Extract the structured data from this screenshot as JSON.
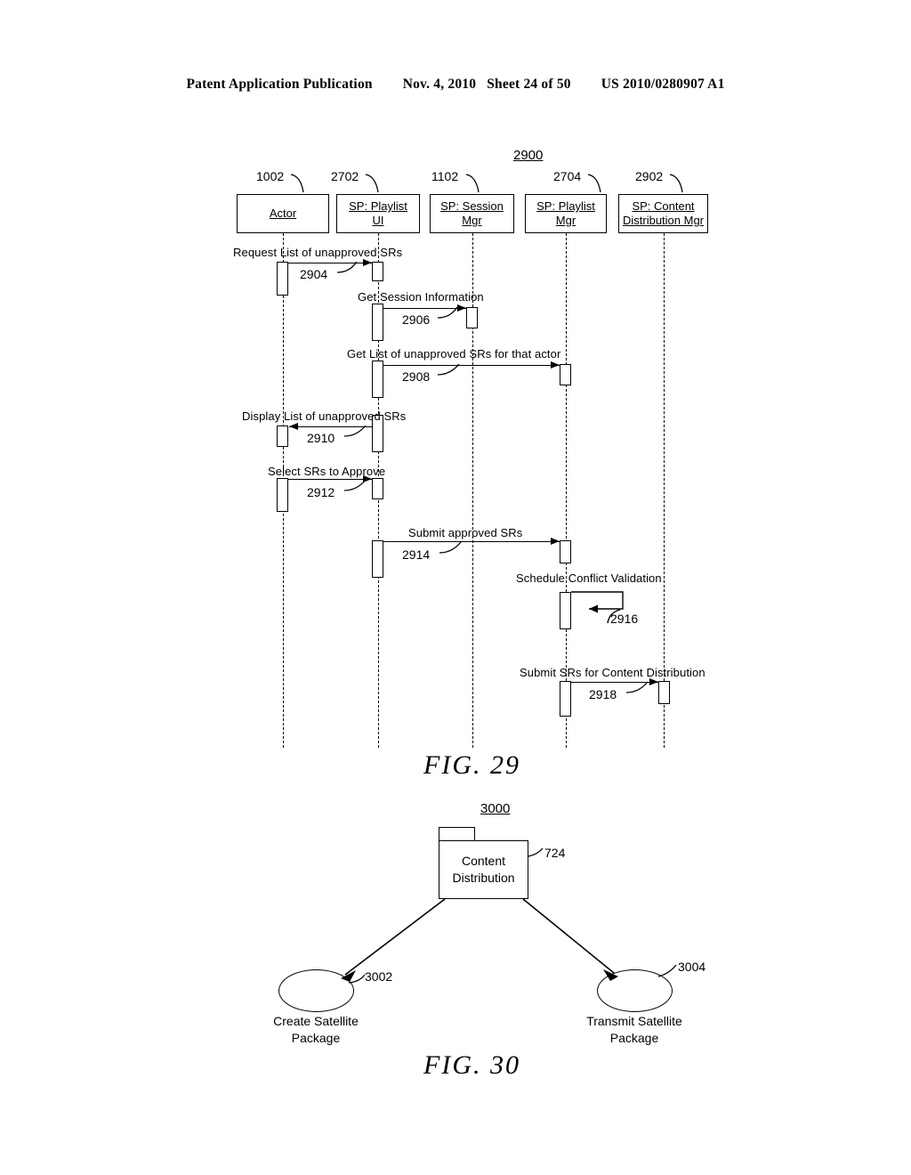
{
  "header": {
    "publication": "Patent Application Publication",
    "date": "Nov. 4, 2010",
    "sheet": "Sheet 24 of 50",
    "patent_number": "US 2010/0280907 A1"
  },
  "fig29": {
    "caption": "FIG.  29",
    "diagram_id": "2900",
    "lifelines": [
      {
        "ref": "1002",
        "label_lines": [
          "Actor"
        ]
      },
      {
        "ref": "2702",
        "label_lines": [
          "SP: Playlist",
          "UI"
        ]
      },
      {
        "ref": "1102",
        "label_lines": [
          "SP: Session",
          "Mgr"
        ]
      },
      {
        "ref": "2704",
        "label_lines": [
          "SP: Playlist",
          "Mgr"
        ]
      },
      {
        "ref": "2902",
        "label_lines": [
          "SP: Content",
          "Distribution Mgr"
        ]
      }
    ],
    "messages": [
      {
        "ref": "2904",
        "label": "Request List of unapproved SRs",
        "from": "Actor",
        "to": "SP: Playlist UI",
        "direction": "right"
      },
      {
        "ref": "2906",
        "label": "Get Session Information",
        "from": "SP: Playlist UI",
        "to": "SP: Session Mgr",
        "direction": "right"
      },
      {
        "ref": "2908",
        "label": "Get List of unapproved SRs for that actor",
        "from": "SP: Playlist UI",
        "to": "SP: Playlist Mgr",
        "direction": "right"
      },
      {
        "ref": "2910",
        "label": "Display List of unapproved SRs",
        "from": "SP: Playlist UI",
        "to": "Actor",
        "direction": "left"
      },
      {
        "ref": "2912",
        "label": "Select SRs to Approve",
        "from": "Actor",
        "to": "SP: Playlist UI",
        "direction": "right"
      },
      {
        "ref": "2914",
        "label": "Submit approved SRs",
        "from": "SP: Playlist UI",
        "to": "SP: Playlist Mgr",
        "direction": "right"
      },
      {
        "ref": "2916",
        "label": "Schedule Conflict Validation",
        "from": "SP: Playlist Mgr",
        "to": "SP: Playlist Mgr",
        "direction": "self"
      },
      {
        "ref": "2918",
        "label": "Submit SRs for Content Distribution",
        "from": "SP: Playlist Mgr",
        "to": "SP: Content Distribution Mgr",
        "direction": "right"
      }
    ]
  },
  "fig30": {
    "caption": "FIG.  30",
    "diagram_id": "3000",
    "package": {
      "ref": "724",
      "label_lines": [
        "Content",
        "Distribution"
      ]
    },
    "nodes": [
      {
        "ref": "3002",
        "label_lines": [
          "Create Satellite",
          "Package"
        ]
      },
      {
        "ref": "3004",
        "label_lines": [
          "Transmit Satellite",
          "Package"
        ]
      }
    ]
  }
}
